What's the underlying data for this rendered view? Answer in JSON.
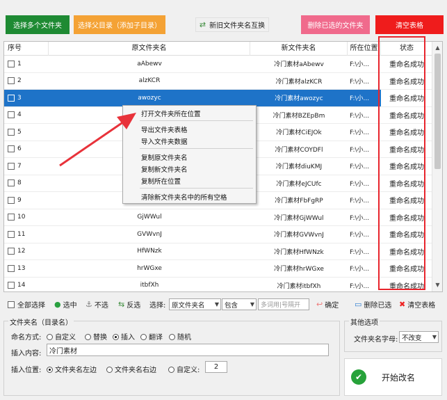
{
  "toolbar": {
    "select_multi": "选择多个文件夹",
    "select_parent": "选择父目录（添加子目录）",
    "swap": "新旧文件夹名互换",
    "delete_selected": "删除已选的文件夹",
    "clear_table": "清空表格",
    "colors": {
      "green": "#1e8a33",
      "orange": "#f4a235",
      "pink": "#f06a8c",
      "red": "#ef1c1c"
    }
  },
  "table": {
    "headers": [
      "序号",
      "原文件夹名",
      "新文件夹名",
      "所在位置",
      "状态"
    ],
    "rows": [
      {
        "no": "1",
        "orig": "aAbewv",
        "new": "冷门素材aAbewv",
        "loc": "F:\\小...",
        "status": "重命名成功"
      },
      {
        "no": "2",
        "orig": "alzKCR",
        "new": "冷门素材alzKCR",
        "loc": "F:\\小...",
        "status": "重命名成功"
      },
      {
        "no": "3",
        "orig": "awozyc",
        "new": "冷门素材awozyc",
        "loc": "F:\\小...",
        "status": "重命名成功"
      },
      {
        "no": "4",
        "orig": "",
        "new": "冷门素材BZEpBm",
        "loc": "F:\\小...",
        "status": "重命名成功"
      },
      {
        "no": "5",
        "orig": "",
        "new": "冷门素材CiEJOk",
        "loc": "F:\\小...",
        "status": "重命名成功"
      },
      {
        "no": "6",
        "orig": "",
        "new": "冷门素材COYDFl",
        "loc": "F:\\小...",
        "status": "重命名成功"
      },
      {
        "no": "7",
        "orig": "",
        "new": "冷门素材diuKMJ",
        "loc": "F:\\小...",
        "status": "重命名成功"
      },
      {
        "no": "8",
        "orig": "",
        "new": "冷门素材eJCUfc",
        "loc": "F:\\小...",
        "status": "重命名成功"
      },
      {
        "no": "9",
        "orig": "",
        "new": "冷门素材FbFgRP",
        "loc": "F:\\小...",
        "status": "重命名成功"
      },
      {
        "no": "10",
        "orig": "GjWWul",
        "new": "冷门素材GjWWul",
        "loc": "F:\\小...",
        "status": "重命名成功"
      },
      {
        "no": "11",
        "orig": "GVWvnJ",
        "new": "冷门素材GVWvnJ",
        "loc": "F:\\小...",
        "status": "重命名成功"
      },
      {
        "no": "12",
        "orig": "HfWNzk",
        "new": "冷门素材HfWNzk",
        "loc": "F:\\小...",
        "status": "重命名成功"
      },
      {
        "no": "13",
        "orig": "hrWGxe",
        "new": "冷门素材hrWGxe",
        "loc": "F:\\小...",
        "status": "重命名成功"
      },
      {
        "no": "14",
        "orig": "itbfXh",
        "new": "冷门素材itbfXh",
        "loc": "F:\\小...",
        "status": "重命名成功"
      }
    ],
    "selected_row": "3"
  },
  "context_menu": {
    "items": [
      "打开文件夹所在位置",
      "导出文件夹表格",
      "导入文件夹数据",
      "复制原文件夹名",
      "复制新文件夹名",
      "复制所在位置",
      "清除新文件夹名中的所有空格"
    ]
  },
  "controls": {
    "select_all": "全部选择",
    "check": "选中",
    "uncheck": "不选",
    "invert": "反选",
    "choose_label": "选择:",
    "field_select": "原文件夹名",
    "match_select": "包含",
    "keyword_placeholder": "多词用|号隔开",
    "confirm": "确定",
    "delete_checked": "删除已选",
    "clear_table": "清空表格"
  },
  "rename": {
    "group_title": "文件夹名（目录名）",
    "mode_label": "命名方式:",
    "modes": [
      "自定义",
      "替换",
      "插入",
      "翻译",
      "随机"
    ],
    "mode_selected": "插入",
    "insert_content_label": "插入内容:",
    "insert_content_value": "冷门素材",
    "insert_pos_label": "插入位置:",
    "positions": [
      "文件夹名左边",
      "文件夹名右边",
      "自定义:"
    ],
    "position_selected": "文件夹名左边",
    "custom_pos_value": "2"
  },
  "other": {
    "group_title": "其他选项",
    "case_label": "文件夹名字母:",
    "case_value": "不改变"
  },
  "start_button": "开始改名"
}
